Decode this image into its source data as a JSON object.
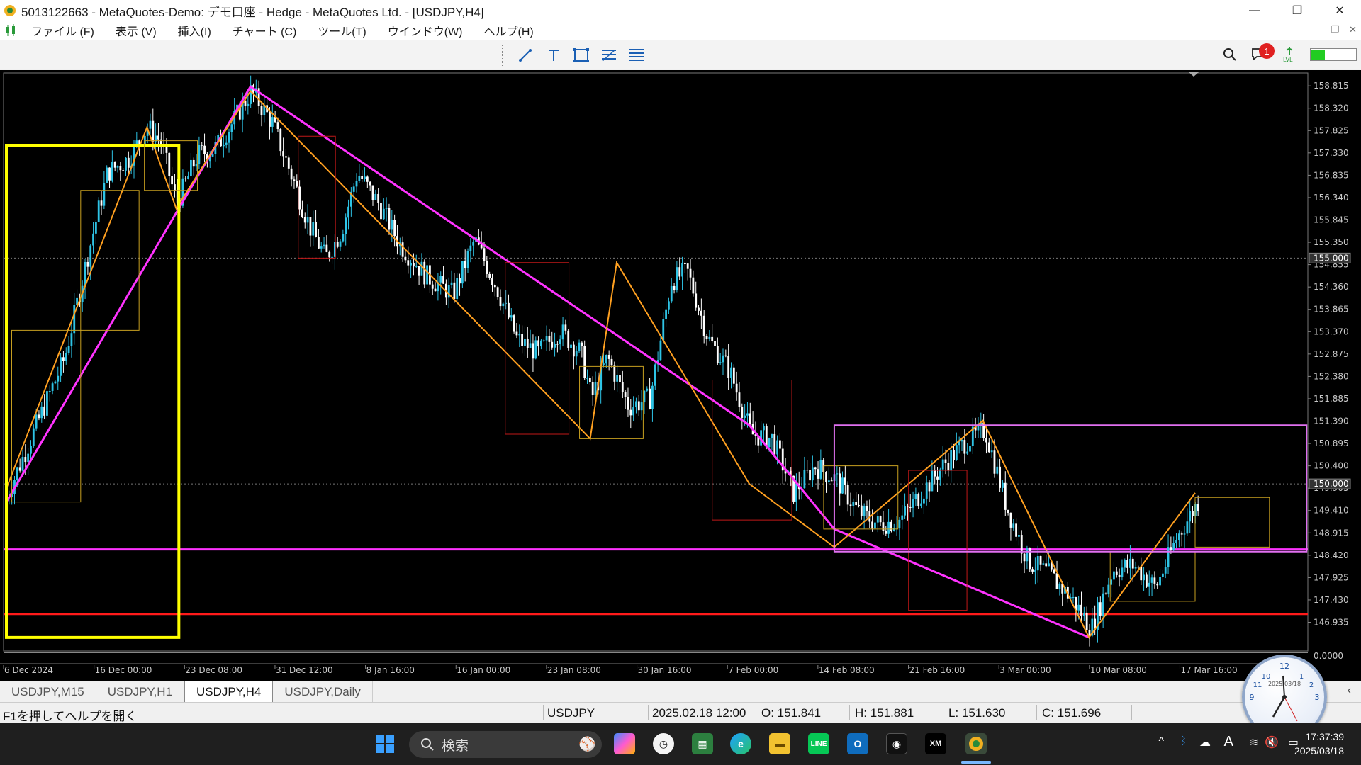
{
  "window": {
    "title": "5013122663 - MetaQuotes-Demo: デモ口座 - Hedge - MetaQuotes Ltd. - [USDJPY,H4]",
    "minimize": "—",
    "maximize": "❐",
    "close": "✕"
  },
  "menu": {
    "items": [
      "ファイル (F)",
      "表示 (V)",
      "挿入(I)",
      "チャート (C)",
      "ツール(T)",
      "ウインドウ(W)",
      "ヘルプ(H)"
    ],
    "mdi_min": "–",
    "mdi_restore": "❐",
    "mdi_close": "✕"
  },
  "toolbar": {
    "tools": [
      "trendline-icon",
      "text-icon",
      "rectangle-icon",
      "fibonacci-icon",
      "channel-icon"
    ],
    "notification_count": "1",
    "signal_level": 0.3
  },
  "chart_data": {
    "type": "candlestick",
    "symbol": "USDJPY",
    "timeframe": "H4",
    "ylim": [
      146.3,
      159.1
    ],
    "y_ticks": [
      "158.815",
      "158.320",
      "157.825",
      "157.330",
      "156.835",
      "156.340",
      "155.845",
      "155.350",
      "154.855",
      "154.360",
      "153.865",
      "153.370",
      "152.875",
      "152.380",
      "151.885",
      "151.390",
      "150.895",
      "150.400",
      "149.905",
      "149.410",
      "148.915",
      "148.420",
      "147.925",
      "147.430",
      "146.935"
    ],
    "price_labels": [
      "155.000",
      "150.000"
    ],
    "indicator_floor": "0.0000",
    "x_ticks": [
      "6 Dec 2024",
      "16 Dec 00:00",
      "23 Dec 08:00",
      "31 Dec 12:00",
      "8 Jan 16:00",
      "16 Jan 00:00",
      "23 Jan 08:00",
      "30 Jan 16:00",
      "7 Feb 00:00",
      "14 Feb 08:00",
      "21 Feb 16:00",
      "3 Mar 00:00",
      "10 Mar 08:00",
      "17 Mar 16:00"
    ],
    "close_path": [
      [
        0,
        149.7
      ],
      [
        0.06,
        151.4
      ],
      [
        0.11,
        152.8
      ],
      [
        0.15,
        154.9
      ],
      [
        0.19,
        156.9
      ],
      [
        0.23,
        157.2
      ],
      [
        0.265,
        157.9
      ],
      [
        0.29,
        157.6
      ],
      [
        0.32,
        156.2
      ],
      [
        0.36,
        157.3
      ],
      [
        0.39,
        157.4
      ],
      [
        0.42,
        157.9
      ],
      [
        0.46,
        158.7
      ],
      [
        0.5,
        158.0
      ],
      [
        0.54,
        156.7
      ],
      [
        0.57,
        155.7
      ],
      [
        0.6,
        155.0
      ],
      [
        0.63,
        155.6
      ],
      [
        0.66,
        156.9
      ],
      [
        0.7,
        156.2
      ],
      [
        0.74,
        155.3
      ],
      [
        0.79,
        154.6
      ],
      [
        0.84,
        154.2
      ],
      [
        0.88,
        155.4
      ],
      [
        0.92,
        154.4
      ],
      [
        0.96,
        153.2
      ],
      [
        1.0,
        152.9
      ],
      [
        1.04,
        153.4
      ],
      [
        1.08,
        152.9
      ],
      [
        1.1,
        151.9
      ],
      [
        1.13,
        152.8
      ],
      [
        1.17,
        151.7
      ],
      [
        1.21,
        151.9
      ],
      [
        1.25,
        154.5
      ],
      [
        1.28,
        154.7
      ],
      [
        1.32,
        153.2
      ],
      [
        1.36,
        152.5
      ],
      [
        1.4,
        151.1
      ],
      [
        1.44,
        151.0
      ],
      [
        1.48,
        149.8
      ],
      [
        1.52,
        150.4
      ],
      [
        1.56,
        150.1
      ],
      [
        1.6,
        149.4
      ],
      [
        1.64,
        149.1
      ],
      [
        1.68,
        149.2
      ],
      [
        1.72,
        149.8
      ],
      [
        1.76,
        150.4
      ],
      [
        1.8,
        150.9
      ],
      [
        1.84,
        151.2
      ],
      [
        1.88,
        149.5
      ],
      [
        1.92,
        148.3
      ],
      [
        1.96,
        148.0
      ],
      [
        2.0,
        147.5
      ],
      [
        2.04,
        146.8
      ],
      [
        2.08,
        148.1
      ],
      [
        2.12,
        148.2
      ],
      [
        2.16,
        147.7
      ],
      [
        2.2,
        148.8
      ],
      [
        2.24,
        149.6
      ]
    ],
    "horizontal_lines": [
      {
        "price": 155.0,
        "color": "#777777",
        "style": "dotted"
      },
      {
        "price": 150.0,
        "color": "#777777",
        "style": "dotted"
      },
      {
        "price": 148.55,
        "color": "#ff33ff",
        "style": "solid"
      },
      {
        "price": 147.12,
        "color": "#ff1a1a",
        "style": "solid"
      }
    ]
  },
  "tabs": [
    "USDJPY,M15",
    "USDJPY,H1",
    "USDJPY,H4",
    "USDJPY,Daily"
  ],
  "active_tab": "USDJPY,H4",
  "status": {
    "help": "F1を押してヘルプを開く",
    "symbol": "USDJPY",
    "datetime": "2025.02.18 12:00",
    "open": "O: 151.841",
    "high": "H: 151.881",
    "low": "L: 151.630",
    "close": "C: 151.696"
  },
  "taskbar": {
    "search_placeholder": "検索",
    "time": "17:37:39",
    "date": "2025/03/18",
    "clock_date": "2025/03/18"
  }
}
